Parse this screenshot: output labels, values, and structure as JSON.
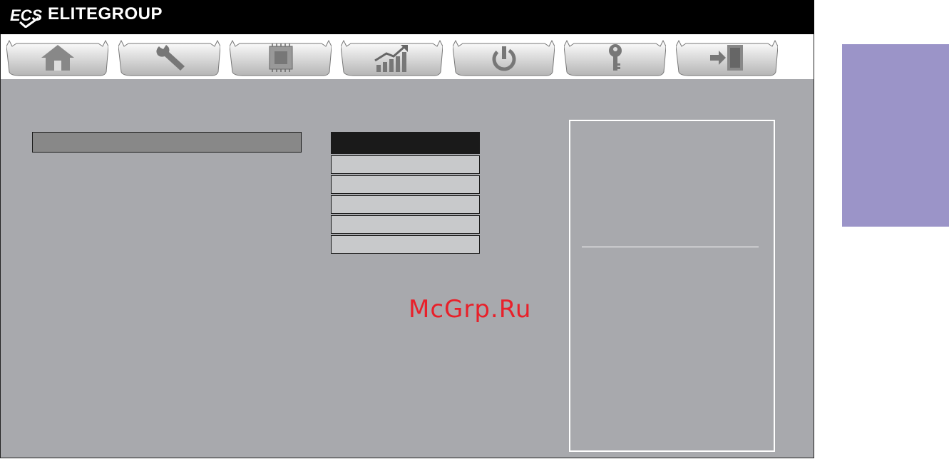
{
  "header": {
    "brand_name": "ELITEGROUP",
    "logo_icon": "ecs-logo-icon"
  },
  "tabs": [
    {
      "name": "tab-main",
      "icon": "home-icon",
      "active": true
    },
    {
      "name": "tab-advanced",
      "icon": "wrench-icon",
      "active": false
    },
    {
      "name": "tab-chipset",
      "icon": "chip-icon",
      "active": false
    },
    {
      "name": "tab-performance",
      "icon": "chart-up-icon",
      "active": false
    },
    {
      "name": "tab-boot",
      "icon": "power-icon",
      "active": false
    },
    {
      "name": "tab-security",
      "icon": "key-icon",
      "active": false
    },
    {
      "name": "tab-exit",
      "icon": "exit-door-icon",
      "active": false
    }
  ],
  "watermark": "McGrp.Ru",
  "colors": {
    "titlebar": "#000000",
    "main_bg": "#a8a9ad",
    "selected_row": "#888888",
    "option_bg": "#c8c9cb",
    "side_tab": "#9b94c8",
    "watermark": "#e8202a"
  }
}
